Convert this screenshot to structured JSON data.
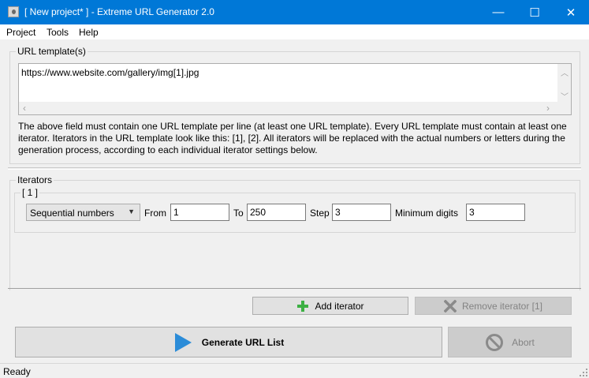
{
  "window": {
    "title": "[ New project* ] - Extreme URL Generator 2.0",
    "controls": {
      "minimize": "—",
      "maximize": "☐",
      "close": "✕"
    }
  },
  "menu": [
    "Project",
    "Tools",
    "Help"
  ],
  "templates": {
    "group_label": "URL template(s)",
    "value": "https://www.website.com/gallery/img[1].jpg",
    "description": "The above field must contain one URL template per line (at least one URL template). Every URL template must contain at least one iterator. Iterators in the URL template look like this: [1], [2]. All iterators will be replaced with the actual numbers or letters during the generation process, according to each individual iterator settings below."
  },
  "iterators": {
    "group_label": "Iterators",
    "items": [
      {
        "label": "[ 1 ]",
        "type": "Sequential numbers",
        "from_label": "From",
        "from": "1",
        "to_label": "To",
        "to": "250",
        "step_label": "Step",
        "step": "3",
        "min_digits_label": "Minimum digits",
        "min_digits": "3"
      }
    ],
    "add_label": "Add iterator",
    "remove_label": "Remove iterator [1]"
  },
  "actions": {
    "generate_label": "Generate URL List",
    "abort_label": "Abort"
  },
  "status": "Ready",
  "colors": {
    "titlebar": "#0078d7",
    "add_icon": "#3cb043",
    "play_icon": "#2b8cd8",
    "disabled_text": "#838383"
  },
  "icons": {
    "add": "plus-icon",
    "remove": "x-icon",
    "generate": "play-icon",
    "abort": "no-entry-icon"
  }
}
